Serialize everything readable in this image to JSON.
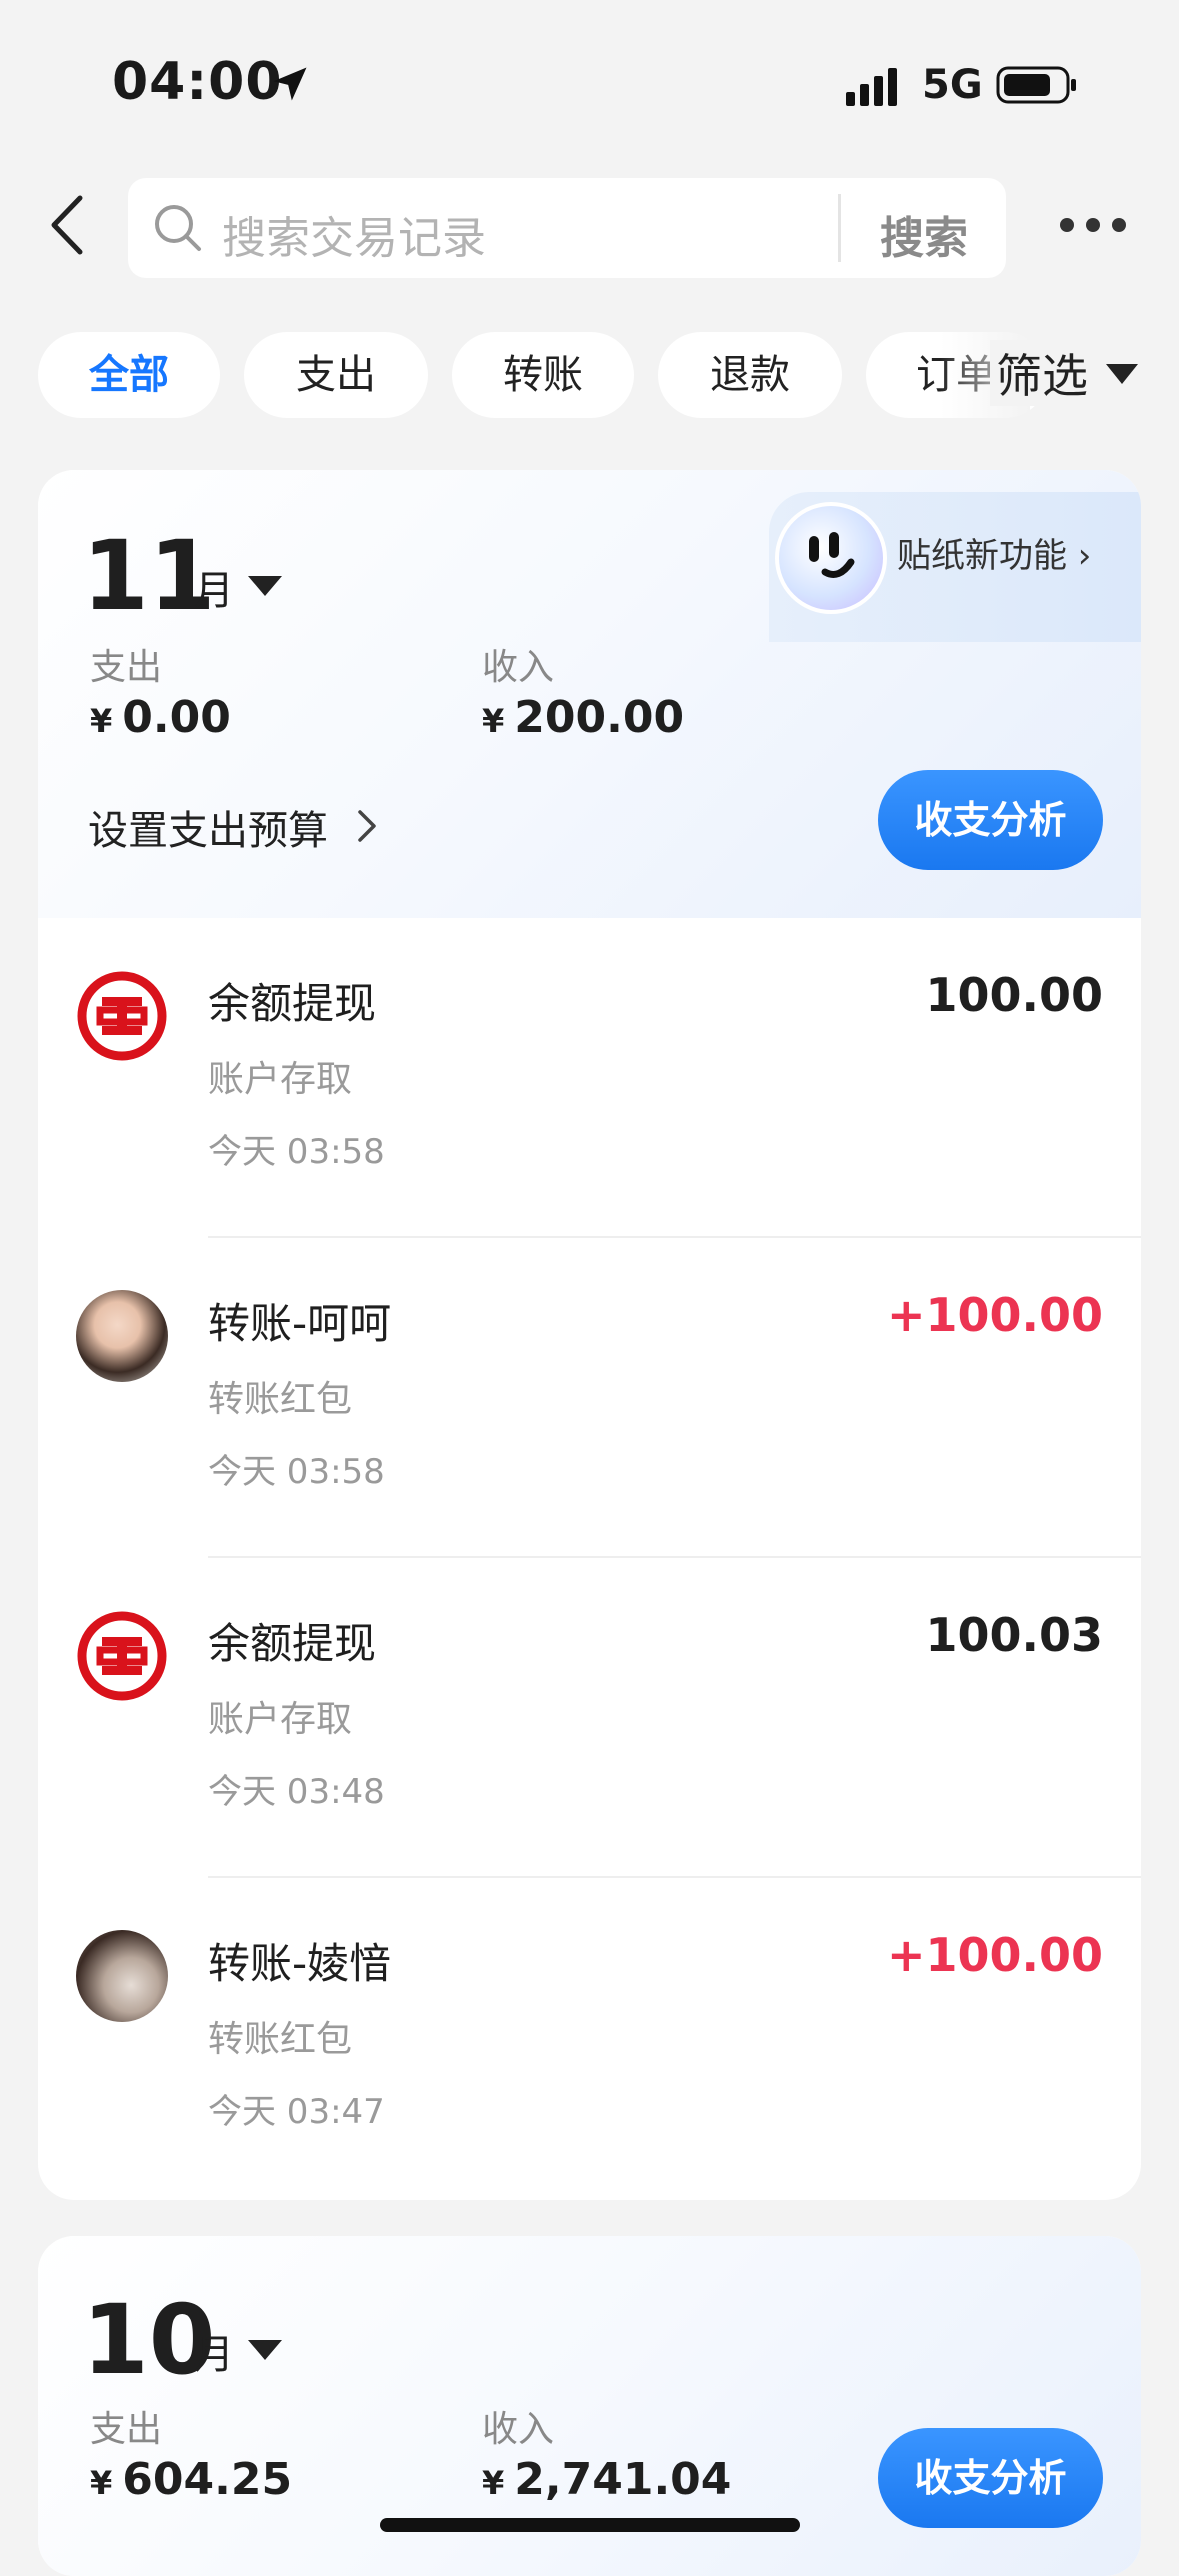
{
  "status_bar": {
    "time": "04:00",
    "network": "5G"
  },
  "search": {
    "placeholder": "搜索交易记录",
    "button": "搜索"
  },
  "tabs": [
    {
      "label": "全部",
      "active": true
    },
    {
      "label": "支出"
    },
    {
      "label": "转账"
    },
    {
      "label": "退款"
    },
    {
      "label": "订单"
    }
  ],
  "filter": {
    "label": "筛选"
  },
  "november": {
    "month": "11",
    "unit": "月",
    "sticker_label": "贴纸新功能",
    "expense_label": "支出",
    "expense_currency": "¥",
    "expense_value": "0.00",
    "income_label": "收入",
    "income_currency": "¥",
    "income_value": "200.00",
    "budget_label": "设置支出预算",
    "analysis_label": "收支分析",
    "transactions": [
      {
        "title": "余额提现",
        "subtitle": "账户存取",
        "time": "今天 03:58",
        "amount": "100.00",
        "icon": "icbc-logo-icon"
      },
      {
        "title": "转账-呵呵",
        "subtitle": "转账红包",
        "time": "今天 03:58",
        "amount": "+100.00",
        "icon": "user-avatar"
      },
      {
        "title": "余额提现",
        "subtitle": "账户存取",
        "time": "今天 03:48",
        "amount": "100.03",
        "icon": "icbc-logo-icon"
      },
      {
        "title": "转账-婈愔",
        "subtitle": "转账红包",
        "time": "今天 03:47",
        "amount": "+100.00",
        "icon": "user-avatar"
      }
    ]
  },
  "october": {
    "month": "10",
    "unit": "月",
    "expense_label": "支出",
    "expense_currency": "¥",
    "expense_value": "604.25",
    "income_label": "收入",
    "income_currency": "¥",
    "income_value": "2,741.04",
    "analysis_label": "收支分析"
  },
  "colors": {
    "accent": "#1677ff",
    "income_red": "#ec3452",
    "icbc_red": "#d9121b"
  }
}
